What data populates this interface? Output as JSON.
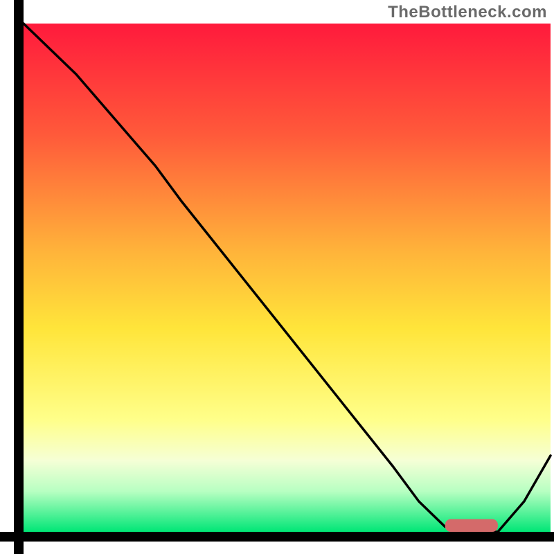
{
  "watermark": "TheBottleneck.com",
  "chart_data": {
    "type": "line",
    "title": "",
    "xlabel": "",
    "ylabel": "",
    "xlim": [
      0,
      100
    ],
    "ylim": [
      0,
      100
    ],
    "grid": false,
    "legend": false,
    "background_gradient": {
      "stops": [
        {
          "offset": 0.0,
          "color": "#ff1a3c"
        },
        {
          "offset": 0.22,
          "color": "#ff5a3a"
        },
        {
          "offset": 0.45,
          "color": "#ffb43a"
        },
        {
          "offset": 0.6,
          "color": "#ffe53a"
        },
        {
          "offset": 0.78,
          "color": "#ffff8a"
        },
        {
          "offset": 0.86,
          "color": "#f5ffd6"
        },
        {
          "offset": 0.92,
          "color": "#b8ffc2"
        },
        {
          "offset": 1.0,
          "color": "#00e676"
        }
      ]
    },
    "series": [
      {
        "name": "bottleneck-curve",
        "color": "#000000",
        "x": [
          0,
          10,
          20,
          25,
          30,
          40,
          50,
          60,
          70,
          75,
          80,
          85,
          90,
          95,
          100
        ],
        "y": [
          100,
          90,
          78,
          72,
          65,
          52,
          39,
          26,
          13,
          6,
          1,
          0,
          0,
          6,
          15
        ]
      }
    ],
    "marker": {
      "name": "optimum-band",
      "color": "#d46a6a",
      "x_start": 80,
      "x_end": 90,
      "y": 0,
      "thickness": 2.5
    },
    "axes": {
      "left": {
        "visible": true,
        "color": "#000000"
      },
      "bottom": {
        "visible": true,
        "color": "#000000"
      },
      "top": {
        "visible": false
      },
      "right": {
        "visible": false
      }
    }
  }
}
